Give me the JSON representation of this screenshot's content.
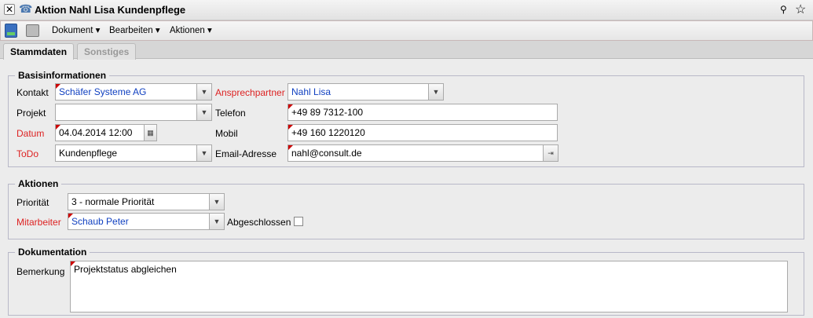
{
  "window": {
    "title": "Aktion Nahl Lisa Kundenpflege"
  },
  "toolbar": {
    "menus": [
      "Dokument",
      "Bearbeiten",
      "Aktionen"
    ]
  },
  "tabs": [
    "Stammdaten",
    "Sonstiges"
  ],
  "basis": {
    "legend": "Basisinformationen",
    "kontakt_label": "Kontakt",
    "kontakt_value": "Schäfer Systeme AG",
    "projekt_label": "Projekt",
    "projekt_value": "",
    "datum_label": "Datum",
    "datum_value": "04.04.2014 12:00",
    "todo_label": "ToDo",
    "todo_value": "Kundenpflege",
    "ansprech_label": "Ansprechpartner",
    "ansprech_value": "Nahl Lisa",
    "telefon_label": "Telefon",
    "telefon_value": "+49 89 7312-100",
    "mobil_label": "Mobil",
    "mobil_value": "+49 160 1220120",
    "email_label": "Email-Adresse",
    "email_value": "nahl@consult.de"
  },
  "aktionen": {
    "legend": "Aktionen",
    "prio_label": "Priorität",
    "prio_value": "3 - normale Priorität",
    "mitarb_label": "Mitarbeiter",
    "mitarb_value": "Schaub Peter",
    "abg_label": "Abgeschlossen",
    "abg_checked": false
  },
  "doku": {
    "legend": "Dokumentation",
    "bem_label": "Bemerkung",
    "bem_value": "Projektstatus abgleichen"
  }
}
